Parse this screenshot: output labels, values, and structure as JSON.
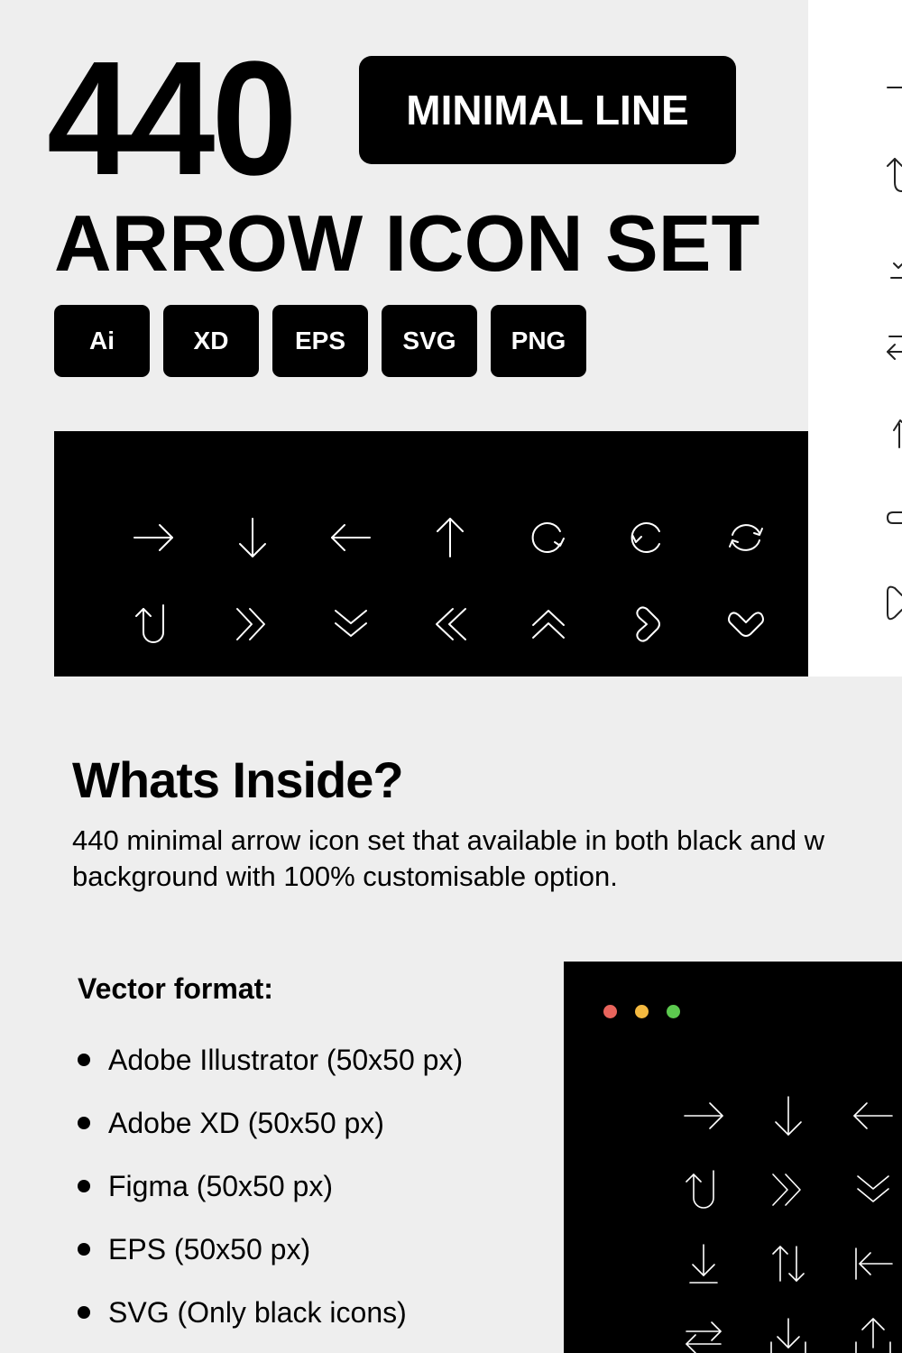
{
  "header": {
    "count": "440",
    "tag": "MINIMAL LINE",
    "title": "ARROW ICON SET",
    "formats": [
      "Ai",
      "XD",
      "EPS",
      "SVG",
      "PNG"
    ]
  },
  "preview_dark": {
    "background": "#000000",
    "icon_color": "#ffffff",
    "rows": [
      [
        "arrow-right",
        "arrow-down",
        "arrow-left",
        "arrow-up",
        "rotate-clockwise",
        "rotate-counterclockwise",
        "refresh"
      ],
      [
        "u-turn-up",
        "chevrons-double-right",
        "chevrons-double-down",
        "chevrons-double-left",
        "chevrons-double-up",
        "rounded-chevron-right",
        "rounded-chevron-down"
      ]
    ]
  },
  "preview_light": {
    "background": "#ffffff",
    "icon_color": "#000000",
    "icons": [
      "arrow-right-partial",
      "u-turn-up-partial",
      "download-tray-partial",
      "arrows-swap-partial",
      "arrow-up-partial",
      "pill-partial",
      "rounded-arrow-partial"
    ]
  },
  "whats_inside": {
    "title": "Whats Inside?",
    "description_line1": "440 minimal arrow icon set that available in both black and w",
    "description_line2": "background with 100% customisable option."
  },
  "vector_format": {
    "title": "Vector format:",
    "items": [
      "Adobe Illustrator (50x50 px)",
      "Adobe XD (50x50 px)",
      "Figma (50x50 px)",
      "EPS (50x50 px)",
      "SVG (Only black icons)"
    ]
  },
  "mock_window": {
    "traffic_lights": [
      "#e8645c",
      "#f4b940",
      "#5cc94f"
    ],
    "rows": [
      [
        "arrow-right",
        "arrow-down",
        "arrow-left"
      ],
      [
        "u-turn-up",
        "chevrons-double-right",
        "chevrons-double-down"
      ],
      [
        "download",
        "arrows-up-down",
        "arrow-left-to-bar"
      ],
      [
        "arrows-swap-horizontal",
        "download-tray",
        "upload-tray"
      ]
    ]
  }
}
